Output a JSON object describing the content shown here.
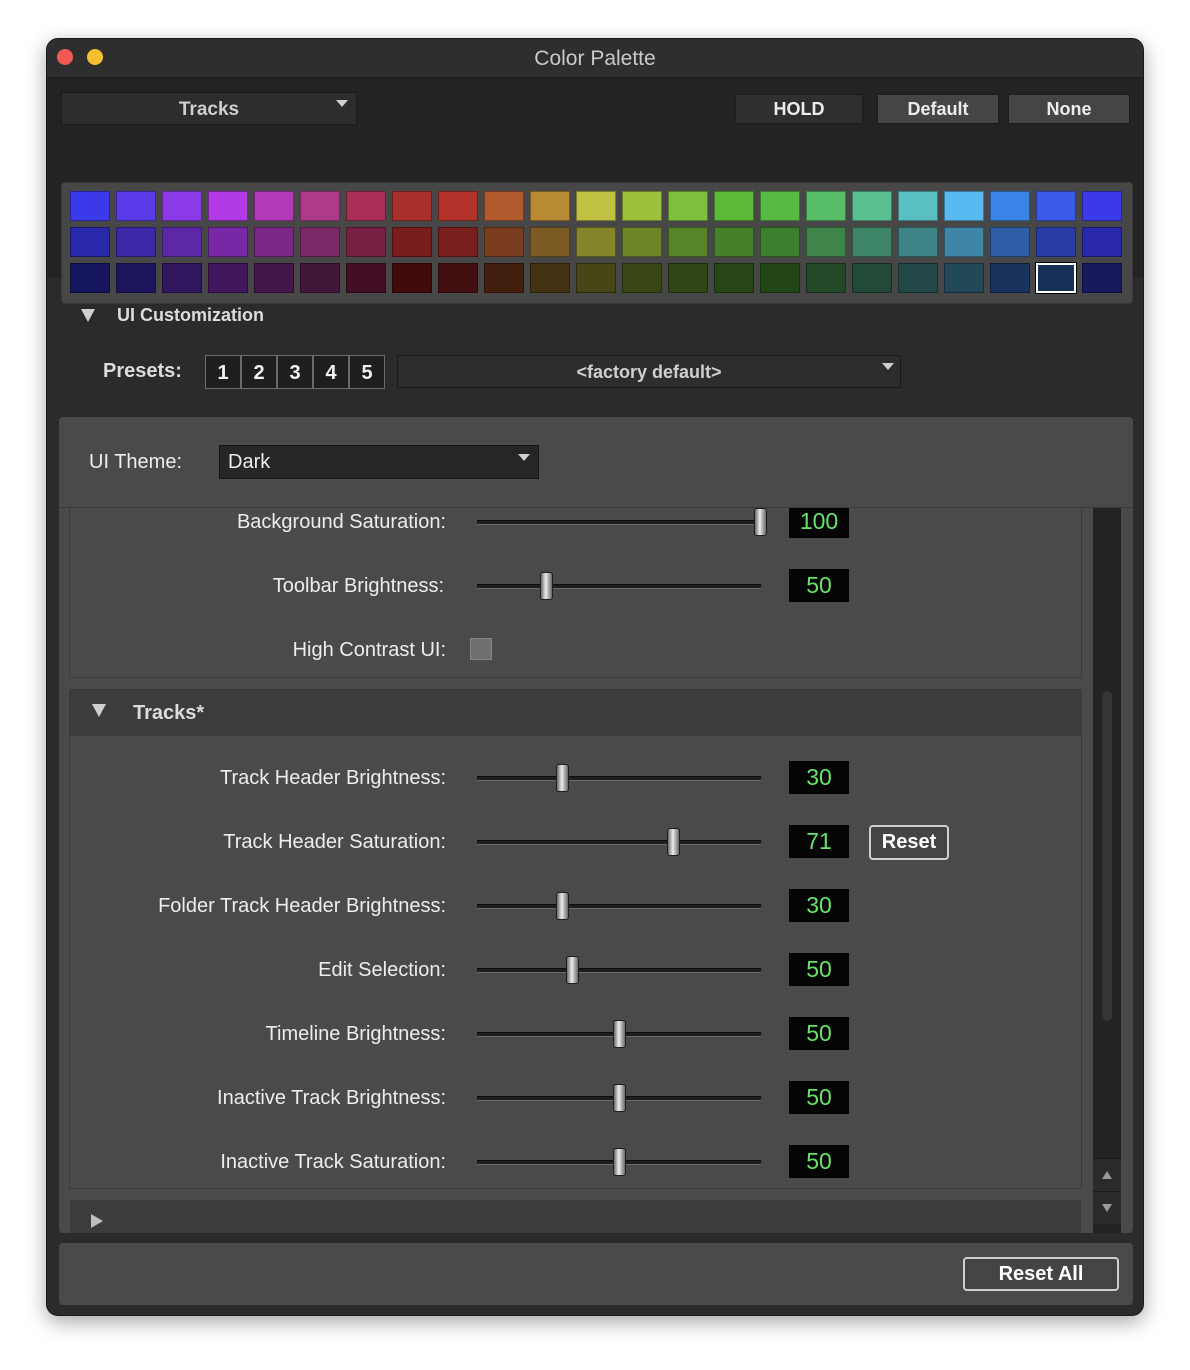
{
  "window": {
    "title": "Color Palette"
  },
  "toolbar": {
    "target_dropdown": "Tracks",
    "hold_label": "HOLD",
    "default_label": "Default",
    "none_label": "None"
  },
  "palette": {
    "rows": [
      [
        "#3a3ae8",
        "#5a3ae8",
        "#8a3ae6",
        "#b23ae6",
        "#b03ab8",
        "#ae3a8a",
        "#a82e58",
        "#a8302c",
        "#b0322a",
        "#b05a2e",
        "#b88a34",
        "#c0c042",
        "#9ec03c",
        "#7ec03c",
        "#5cba38",
        "#56ba44",
        "#58be6a",
        "#58c090",
        "#58c0c0",
        "#58b8f0",
        "#3a84e8",
        "#3a5ae8",
        "#3a3ae8"
      ],
      [
        "#2828a8",
        "#3a28a6",
        "#5c28a6",
        "#7828a6",
        "#7a2886",
        "#7a2866",
        "#782044",
        "#781c1c",
        "#781e1c",
        "#7a3c1e",
        "#7c5c24",
        "#84842a",
        "#6e8428",
        "#588428",
        "#468028",
        "#3e802e",
        "#3e844a",
        "#3e8466",
        "#3e8486",
        "#3e84a6",
        "#2e5ea6",
        "#2a3ca6",
        "#2828a8"
      ],
      [
        "#16165e",
        "#1e165c",
        "#30165c",
        "#40165c",
        "#42164a",
        "#421638",
        "#420f24",
        "#420a0a",
        "#421010",
        "#421e0e",
        "#443214",
        "#464616",
        "#3a4616",
        "#304616",
        "#264616",
        "#224618",
        "#224828",
        "#224838",
        "#224848",
        "#224858",
        "#18325c",
        "#183058",
        "#181a5e"
      ]
    ],
    "selected": {
      "row": 2,
      "col": 21
    }
  },
  "ui_customization": {
    "header": "UI Customization",
    "presets_label": "Presets:",
    "presets": [
      "1",
      "2",
      "3",
      "4",
      "5"
    ],
    "preset_dropdown": "<factory default>",
    "theme_label": "UI Theme:",
    "theme_value": "Dark"
  },
  "general_settings": [
    {
      "label": "Background Saturation:",
      "value": "100",
      "level": 1.0
    },
    {
      "label": "Toolbar Brightness:",
      "value": "50",
      "level": 0.24
    },
    {
      "label": "High Contrast UI:",
      "type": "checkbox",
      "checked": false
    }
  ],
  "tracks_section": {
    "header": "Tracks*",
    "settings": [
      {
        "label": "Track Header Brightness:",
        "value": "30",
        "level": 0.29
      },
      {
        "label": "Track Header Saturation:",
        "value": "71",
        "level": 0.7,
        "reset": "Reset"
      },
      {
        "label": "Folder Track Header Brightness:",
        "value": "30",
        "level": 0.29
      },
      {
        "label": "Edit Selection:",
        "value": "50",
        "level": 0.33
      },
      {
        "label": "Timeline Brightness:",
        "value": "50",
        "level": 0.5
      },
      {
        "label": "Inactive Track Brightness:",
        "value": "50",
        "level": 0.5
      },
      {
        "label": "Inactive Track Saturation:",
        "value": "50",
        "level": 0.5
      }
    ]
  },
  "footer": {
    "reset_all_label": "Reset All"
  }
}
